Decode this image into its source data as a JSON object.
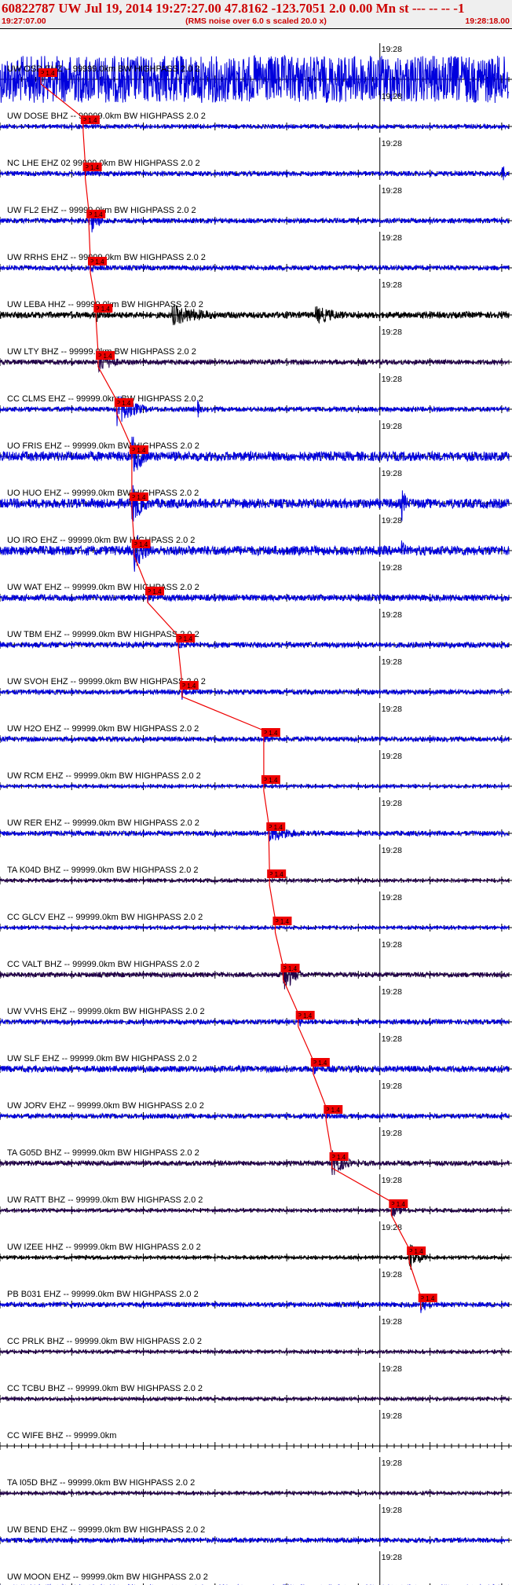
{
  "header": {
    "title": "60822787 UW Jul 19, 2014 19:27:27.00   47.8162 -123.7051  2.0 0.00 Mn st --- -- --  -1",
    "start_time": "19:27:07.00",
    "subtitle": "(RMS noise over 6.0 s scaled 20.0 x)",
    "end_time": "19:28:18.00"
  },
  "chart_data": {
    "type": "line",
    "x_unit": "seconds after 19:27:07.00",
    "xlim": [
      0,
      71
    ],
    "minute_mark": {
      "time": 53,
      "label": "19:28"
    },
    "pick_label": "P 1.4",
    "colors": {
      "trace_blue": "#0000dd",
      "trace_black": "#000000",
      "trace_purple": "#22004a",
      "pick": "#ee0000"
    },
    "traces": [
      {
        "label": "UW OSD EHZ -- 99999.0km BW  HIGHPASS  2.0  2",
        "color": "trace_blue",
        "pick": 5.7,
        "noise": 3,
        "bursts": [
          [
            0,
            71,
            30
          ]
        ]
      },
      {
        "label": "UW DOSE BHZ -- 99999.0km BW  HIGHPASS  2.0  2",
        "color": "trace_blue",
        "pick": 11.6,
        "noise": 2.5,
        "bursts": []
      },
      {
        "label": "NC LHE EHZ 02 99999.0km BW  HIGHPASS  2.0  2",
        "color": "trace_blue",
        "pick": 11.9,
        "noise": 3,
        "bursts": [
          [
            70,
            71,
            22
          ]
        ]
      },
      {
        "label": "UW FL2 EHZ -- 99999.0km BW  HIGHPASS  2.0  2",
        "color": "trace_blue",
        "pick": 12.4,
        "noise": 3,
        "bursts": [
          [
            12.4,
            16,
            24
          ]
        ]
      },
      {
        "label": "UW RRHS EHZ -- 99999.0km BW  HIGHPASS  2.0  2",
        "color": "trace_blue",
        "pick": 12.6,
        "noise": 3,
        "bursts": [
          [
            12.6,
            15,
            10
          ]
        ]
      },
      {
        "label": "UW LEBA HHZ -- 99999.0km BW  HIGHPASS  2.0  2",
        "color": "trace_black",
        "pick": 13.4,
        "noise": 4,
        "bursts": [
          [
            13.4,
            15,
            12
          ],
          [
            24,
            40,
            14
          ],
          [
            44,
            56,
            12
          ]
        ]
      },
      {
        "label": "UW LTY BHZ -- 99999.0km BW  HIGHPASS  2.0  2",
        "color": "trace_purple",
        "pick": 13.7,
        "noise": 3,
        "bursts": [
          [
            13.7,
            20,
            16
          ]
        ]
      },
      {
        "label": "CC CLMS EHZ -- 99999.0km BW  HIGHPASS  2.0  2",
        "color": "trace_blue",
        "pick": 16.3,
        "noise": 3,
        "bursts": [
          [
            16.3,
            24,
            22
          ],
          [
            27.5,
            29,
            14
          ]
        ]
      },
      {
        "label": "UO FRIS EHZ -- 99999.0km BW  HIGHPASS  2.0  2",
        "color": "trace_blue",
        "pick": 18.4,
        "noise": 6,
        "bursts": [
          [
            18.4,
            23,
            30
          ]
        ]
      },
      {
        "label": "UO HUO EHZ -- 99999.0km BW  HIGHPASS  2.0  2",
        "color": "trace_blue",
        "pick": 18.4,
        "noise": 6,
        "bursts": [
          [
            18.4,
            23,
            30
          ],
          [
            56,
            58,
            26
          ]
        ]
      },
      {
        "label": "UO IRO EHZ -- 99999.0km BW  HIGHPASS  2.0  2",
        "color": "trace_blue",
        "pick": 18.7,
        "noise": 6,
        "bursts": [
          [
            18.7,
            23,
            30
          ],
          [
            56,
            58,
            16
          ]
        ]
      },
      {
        "label": "UW WAT EHZ -- 99999.0km BW  HIGHPASS  2.0  2",
        "color": "trace_blue",
        "pick": 20.6,
        "noise": 4,
        "bursts": [
          [
            20.6,
            23,
            12
          ]
        ]
      },
      {
        "label": "UW TBM EHZ -- 99999.0km BW  HIGHPASS  2.0  2",
        "color": "trace_blue",
        "pick": 24.9,
        "noise": 3.5,
        "bursts": [
          [
            24.9,
            27,
            8
          ]
        ]
      },
      {
        "label": "UW SVOH EHZ -- 99999.0km BW  HIGHPASS  2.0  2",
        "color": "trace_blue",
        "pick": 25.4,
        "noise": 3,
        "bursts": [
          [
            25.4,
            27,
            10
          ]
        ]
      },
      {
        "label": "UW H2O EHZ -- 99999.0km BW  HIGHPASS  2.0  2",
        "color": "trace_blue",
        "pick": 36.8,
        "noise": 3,
        "bursts": [
          [
            36.8,
            39,
            8
          ]
        ]
      },
      {
        "label": "UW RCM EHZ -- 99999.0km BW  HIGHPASS  2.0  2",
        "color": "trace_blue",
        "pick": 36.8,
        "noise": 2,
        "bursts": []
      },
      {
        "label": "UW RER EHZ -- 99999.0km BW  HIGHPASS  2.0  2",
        "color": "trace_blue",
        "pick": 37.5,
        "noise": 3,
        "bursts": [
          [
            37.5,
            49,
            12
          ]
        ]
      },
      {
        "label": "TA K04D BHZ -- 99999.0km BW  HIGHPASS  2.0  2",
        "color": "trace_purple",
        "pick": 37.6,
        "noise": 2,
        "bursts": []
      },
      {
        "label": "CC GLCV EHZ -- 99999.0km BW  HIGHPASS  2.0  2",
        "color": "trace_blue",
        "pick": 38.4,
        "noise": 2,
        "bursts": []
      },
      {
        "label": "CC VALT BHZ -- 99999.0km BW  HIGHPASS  2.0  2",
        "color": "trace_purple",
        "pick": 39.5,
        "noise": 3,
        "bursts": [
          [
            39.5,
            44,
            26
          ]
        ]
      },
      {
        "label": "UW VVHS EHZ -- 99999.0km BW  HIGHPASS  2.0  2",
        "color": "trace_blue",
        "pick": 41.6,
        "noise": 3,
        "bursts": [
          [
            41.6,
            43,
            10
          ]
        ]
      },
      {
        "label": "UW SLF EHZ -- 99999.0km BW  HIGHPASS  2.0  2",
        "color": "trace_blue",
        "pick": 43.7,
        "noise": 4,
        "bursts": [
          [
            43.7,
            46,
            10
          ]
        ]
      },
      {
        "label": "UW JORV EHZ -- 99999.0km BW  HIGHPASS  2.0  2",
        "color": "trace_blue",
        "pick": 45.5,
        "noise": 3,
        "bursts": [
          [
            45.5,
            47,
            8
          ]
        ]
      },
      {
        "label": "TA G05D BHZ -- 99999.0km BW  HIGHPASS  2.0  2",
        "color": "trace_purple",
        "pick": 46.3,
        "noise": 3,
        "bursts": [
          [
            46.3,
            52,
            18
          ]
        ]
      },
      {
        "label": "UW RATT BHZ -- 99999.0km BW  HIGHPASS  2.0  2",
        "color": "trace_purple",
        "pick": 54.6,
        "noise": 2,
        "bursts": [
          [
            54.6,
            60,
            10
          ]
        ]
      },
      {
        "label": "UW IZEE HHZ -- 99999.0km BW  HIGHPASS  2.0  2",
        "color": "trace_black",
        "pick": 57.1,
        "noise": 2,
        "bursts": [
          [
            57.1,
            61,
            22
          ]
        ]
      },
      {
        "label": "PB B031 EHZ -- 99999.0km BW  HIGHPASS  2.0  2",
        "color": "trace_blue",
        "pick": 58.7,
        "noise": 3,
        "bursts": [
          [
            58.7,
            61,
            16
          ]
        ]
      },
      {
        "label": "CC PRLK BHZ -- 99999.0km BW  HIGHPASS  2.0  2",
        "color": "trace_purple",
        "pick": null,
        "noise": 2,
        "bursts": []
      },
      {
        "label": "CC TCBU BHZ -- 99999.0km BW  HIGHPASS  2.0  2",
        "color": "trace_purple",
        "pick": null,
        "noise": 2,
        "bursts": []
      },
      {
        "label": "CC WIFE BHZ -- 99999.0km",
        "color": "trace_purple",
        "pick": null,
        "noise": 0,
        "bursts": []
      },
      {
        "label": "TA I05D BHZ -- 99999.0km BW  HIGHPASS  2.0  2",
        "color": "trace_purple",
        "pick": null,
        "noise": 2,
        "bursts": []
      },
      {
        "label": "UW BEND EHZ -- 99999.0km BW  HIGHPASS  2.0  2",
        "color": "trace_blue",
        "pick": null,
        "noise": 3,
        "bursts": []
      },
      {
        "label": "UW MOON EHZ -- 99999.0km BW  HIGHPASS  2.0  2",
        "color": "trace_blue",
        "pick": null,
        "noise": 3,
        "bursts": []
      }
    ]
  }
}
